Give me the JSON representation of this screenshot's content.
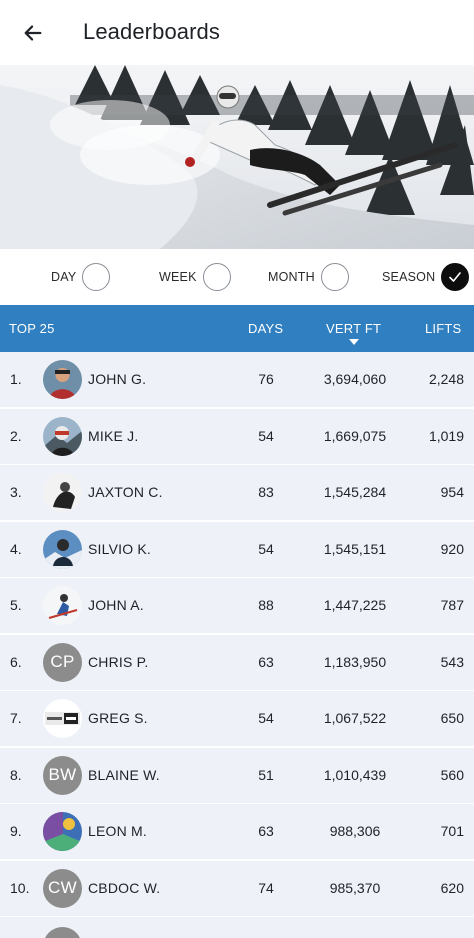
{
  "header": {
    "title": "Leaderboards",
    "back_icon": "arrow-left-icon"
  },
  "hero": {
    "icon": "skier-photo"
  },
  "filters": [
    {
      "label": "DAY",
      "checked": false
    },
    {
      "label": "WEEK",
      "checked": false
    },
    {
      "label": "MONTH",
      "checked": false
    },
    {
      "label": "SEASON",
      "checked": true
    }
  ],
  "table": {
    "columns": {
      "title": "TOP 25",
      "days": "DAYS",
      "vert": "VERT FT",
      "lifts": "LIFTS"
    },
    "header_color": "#2f7fc1",
    "row_color": "#eef2f8",
    "rows": [
      {
        "rank": "1.",
        "name": "JOHN G.",
        "days": "76",
        "vert": "3,694,060",
        "lifts": "2,248",
        "avatar": "photo"
      },
      {
        "rank": "2.",
        "name": "MIKE J.",
        "days": "54",
        "vert": "1,669,075",
        "lifts": "1,019",
        "avatar": "photo"
      },
      {
        "rank": "3.",
        "name": "JAXTON C.",
        "days": "83",
        "vert": "1,545,284",
        "lifts": "954",
        "avatar": "photo"
      },
      {
        "rank": "4.",
        "name": "SILVIO K.",
        "days": "54",
        "vert": "1,545,151",
        "lifts": "920",
        "avatar": "photo"
      },
      {
        "rank": "5.",
        "name": "JOHN A.",
        "days": "88",
        "vert": "1,447,225",
        "lifts": "787",
        "avatar": "photo"
      },
      {
        "rank": "6.",
        "name": "CHRIS P.",
        "days": "63",
        "vert": "1,183,950",
        "lifts": "543",
        "avatar": "CP"
      },
      {
        "rank": "7.",
        "name": "GREG S.",
        "days": "54",
        "vert": "1,067,522",
        "lifts": "650",
        "avatar": "photo"
      },
      {
        "rank": "8.",
        "name": "BLAINE W.",
        "days": "51",
        "vert": "1,010,439",
        "lifts": "560",
        "avatar": "BW"
      },
      {
        "rank": "9.",
        "name": "LEON M.",
        "days": "63",
        "vert": "988,306",
        "lifts": "701",
        "avatar": "photo"
      },
      {
        "rank": "10.",
        "name": "CBDOC W.",
        "days": "74",
        "vert": "985,370",
        "lifts": "620",
        "avatar": "CW"
      }
    ]
  }
}
